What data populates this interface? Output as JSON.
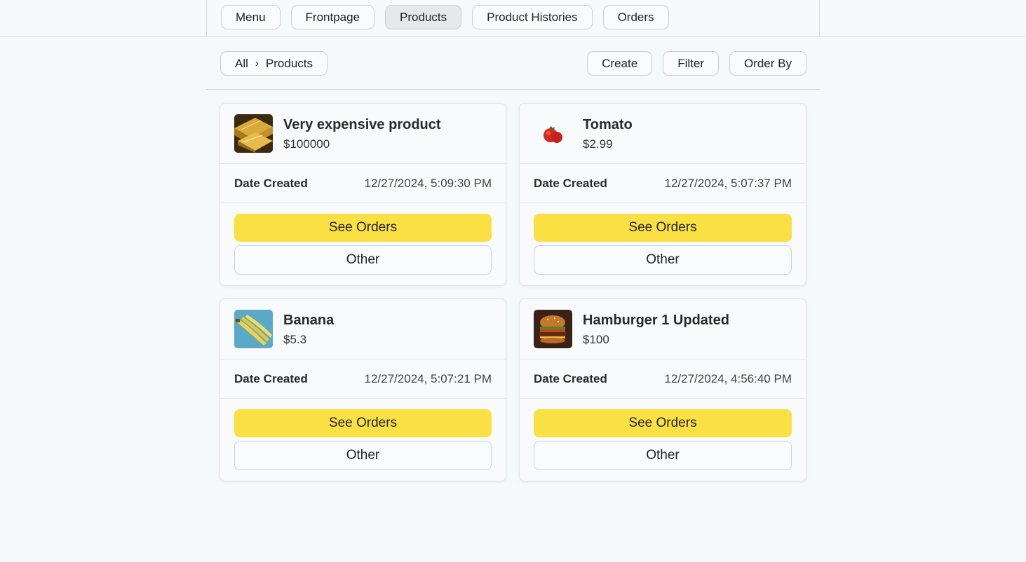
{
  "nav": {
    "items": [
      {
        "label": "Menu",
        "active": false
      },
      {
        "label": "Frontpage",
        "active": false
      },
      {
        "label": "Products",
        "active": true
      },
      {
        "label": "Product Histories",
        "active": false
      },
      {
        "label": "Orders",
        "active": false
      }
    ]
  },
  "breadcrumb": {
    "root": "All",
    "separator": "›",
    "current": "Products"
  },
  "actions": {
    "create": "Create",
    "filter": "Filter",
    "order_by": "Order By"
  },
  "products": [
    {
      "name": "Very expensive product",
      "price": "$100000",
      "date_label": "Date Created",
      "date": "12/27/2024, 5:09:30 PM",
      "primary": "See Orders",
      "secondary": "Other",
      "icon": "gold-bars-image"
    },
    {
      "name": "Tomato",
      "price": "$2.99",
      "date_label": "Date Created",
      "date": "12/27/2024, 5:07:37 PM",
      "primary": "See Orders",
      "secondary": "Other",
      "icon": "tomato-image"
    },
    {
      "name": "Banana",
      "price": "$5.3",
      "date_label": "Date Created",
      "date": "12/27/2024, 5:07:21 PM",
      "primary": "See Orders",
      "secondary": "Other",
      "icon": "banana-image"
    },
    {
      "name": "Hamburger 1 Updated",
      "price": "$100",
      "date_label": "Date Created",
      "date": "12/27/2024, 4:56:40 PM",
      "primary": "See Orders",
      "secondary": "Other",
      "icon": "hamburger-image"
    }
  ],
  "colors": {
    "accent": "#fbe044",
    "background": "#f6f9fa"
  }
}
